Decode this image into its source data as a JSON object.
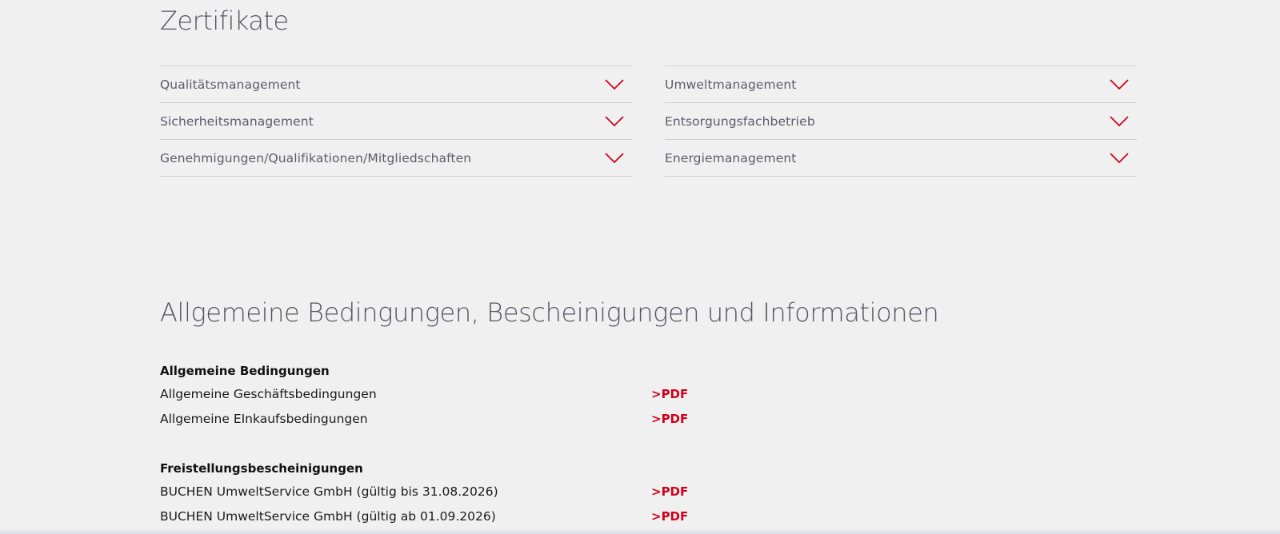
{
  "certificates": {
    "title": "Zertifikate",
    "left": [
      {
        "label": "Qualitätsmanagement"
      },
      {
        "label": "Sicherheitsmanagement"
      },
      {
        "label": "Genehmigungen/Qualifikationen/Mitgliedschaften"
      }
    ],
    "right": [
      {
        "label": "Umweltmanagement"
      },
      {
        "label": "Entsorgungsfachbetrieb"
      },
      {
        "label": "Energiemanagement"
      }
    ],
    "accent_color": "#d0021b"
  },
  "general": {
    "title": "Allgemeine Bedingungen, Bescheinigungen und Informationen",
    "groups": [
      {
        "title": "Allgemeine Bedingungen",
        "rows": [
          {
            "name": "Allgemeine Geschäftsbedingungen",
            "link": ">PDF"
          },
          {
            "name": "Allgemeine EInkaufsbedingungen",
            "link": ">PDF"
          }
        ]
      },
      {
        "title": "Freistellungsbescheinigungen",
        "rows": [
          {
            "name": "BUCHEN UmweltService GmbH (gültig bis 31.08.2026)",
            "link": ">PDF"
          },
          {
            "name": "BUCHEN UmweltService GmbH (gültig ab 01.09.2026)",
            "link": ">PDF"
          }
        ]
      }
    ]
  }
}
